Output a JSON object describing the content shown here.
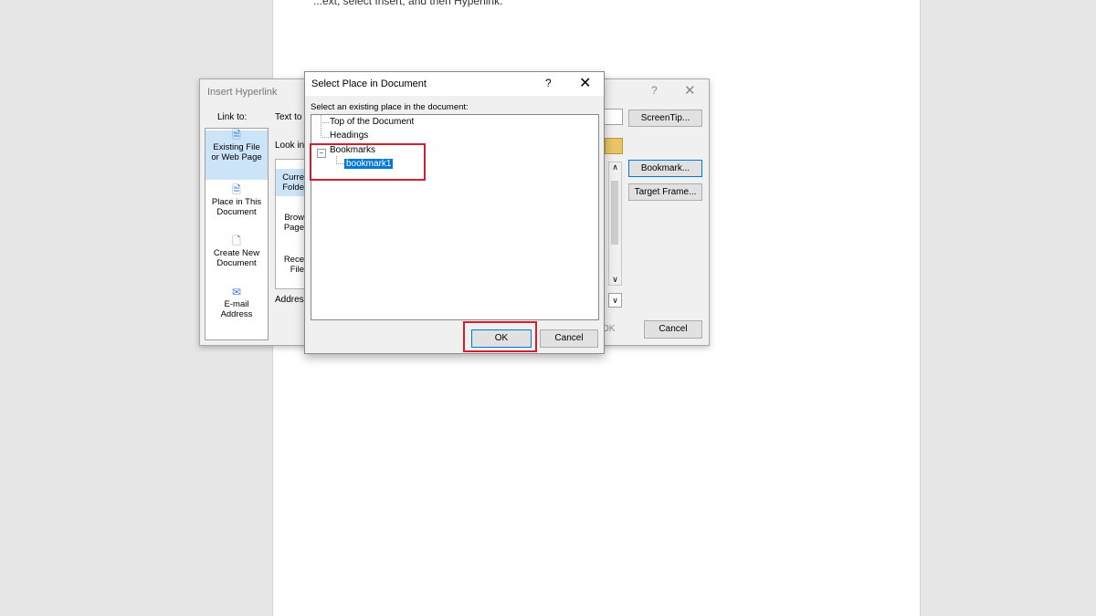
{
  "page": {
    "snippet": "...ext, select Insert, and then Hyperlink."
  },
  "insert_hyperlink": {
    "title": "Insert Hyperlink",
    "help": "?",
    "close": "✕",
    "link_to_label": "Link to:",
    "text_to_display_label": "Text to",
    "look_in_label": "Look in",
    "address_label": "Address",
    "nav": [
      {
        "line1": "Existing File",
        "line2": "or Web Page",
        "icon": "existing-file-icon"
      },
      {
        "line1": "Place in This",
        "line2": "Document",
        "icon": "place-in-document-icon"
      },
      {
        "line1": "Create New",
        "line2": "Document",
        "icon": "new-document-icon"
      },
      {
        "line1": "E-mail",
        "line2": "Address",
        "icon": "email-icon"
      }
    ],
    "mid": [
      {
        "line1": "Curre",
        "line2": "Folde"
      },
      {
        "line1": "Brow",
        "line2": "Page"
      },
      {
        "line1": "Rece",
        "line2": "File"
      }
    ],
    "buttons": {
      "screentip": "ScreenTip...",
      "bookmark": "Bookmark...",
      "target_frame": "Target Frame...",
      "ok_peek": "OK",
      "cancel": "Cancel"
    }
  },
  "select_place": {
    "title": "Select Place in Document",
    "help": "?",
    "close": "✕",
    "instruction": "Select an existing place in the document:",
    "tree": {
      "top": "Top of the Document",
      "headings": "Headings",
      "bookmarks": "Bookmarks",
      "bookmark1": "bookmark1"
    },
    "ok": "OK",
    "cancel": "Cancel"
  },
  "colors": {
    "highlight": "#d01f2e",
    "selection": "#0078d7"
  }
}
